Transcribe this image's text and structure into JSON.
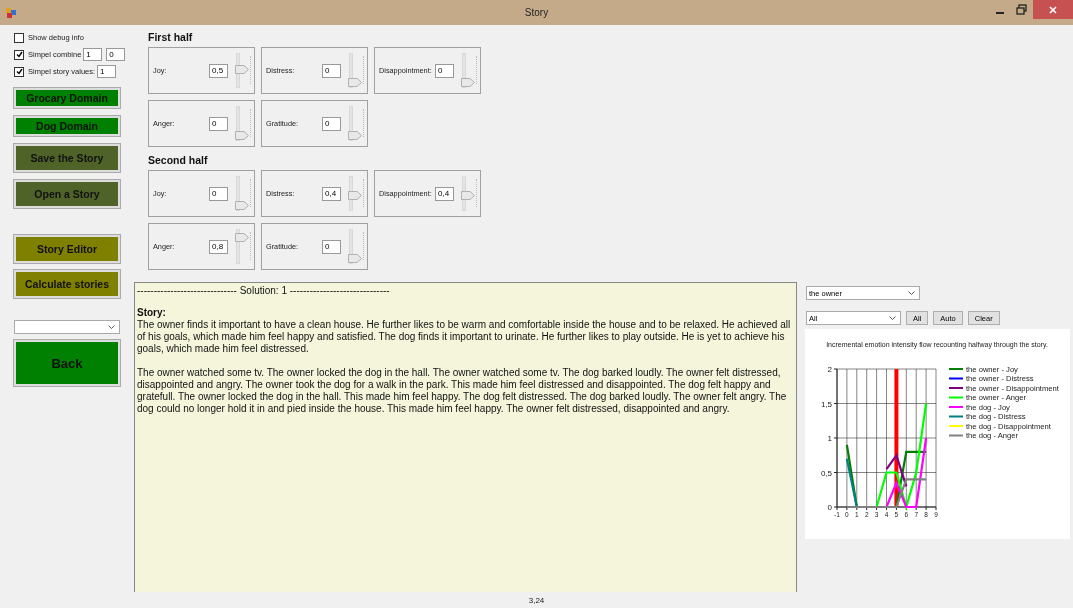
{
  "window": {
    "title": "Story"
  },
  "options": [
    {
      "label": "Show debug info",
      "checked": false
    },
    {
      "label": "Simpel combine",
      "checked": true,
      "fields": [
        "1",
        "0"
      ]
    },
    {
      "label": "Simpel story values:",
      "checked": true,
      "fields": [
        "1"
      ]
    }
  ],
  "actions": [
    {
      "label": "Grocary Domain",
      "kind": "domain"
    },
    {
      "label": "Dog Domain",
      "kind": "domain"
    },
    {
      "label": "Save the Story",
      "kind": "file"
    },
    {
      "label": "Open a Story",
      "kind": "file"
    },
    {
      "label": "Story Editor",
      "kind": "tool"
    },
    {
      "label": "Calculate stories",
      "kind": "tool"
    }
  ],
  "back_button": {
    "label": "Back"
  },
  "halves": [
    {
      "title": "First half",
      "emotions": [
        {
          "label": "Joy:",
          "value": "0,5",
          "level": 0.5
        },
        {
          "label": "Distress:",
          "value": "0",
          "level": 0
        },
        {
          "label": "Disappointment:",
          "value": "0",
          "level": 0
        },
        {
          "label": "Anger:",
          "value": "0",
          "level": 0
        },
        {
          "label": "Gratitude:",
          "value": "0",
          "level": 0
        }
      ]
    },
    {
      "title": "Second half",
      "emotions": [
        {
          "label": "Joy:",
          "value": "0",
          "level": 0
        },
        {
          "label": "Distress:",
          "value": "0,4",
          "level": 0.4
        },
        {
          "label": "Disappointment:",
          "value": "0,4",
          "level": 0.4
        },
        {
          "label": "Anger:",
          "value": "0,8",
          "level": 0.8
        },
        {
          "label": "Gratitude:",
          "value": "0",
          "level": 0
        }
      ]
    }
  ],
  "output": {
    "separator": "------------------------------ Solution: 1 ------------------------------",
    "heading": "Story:",
    "paragraphs": [
      "The owner finds it important to have a clean house. He further likes to be warm and comfortable inside the house and to be relaxed. He achieved all of his goals, which made him feel happy and satisfied. The dog finds it important to urinate. He further likes to play outside. He is yet to achieve his goals, which made him feel distressed.",
      "The owner watched some tv. The owner locked the dog in the hall. The owner watched some tv. The dog barked loudly. The owner felt distressed, disappointed and angry. The owner took the dog for a walk in the park. This made him feel distressed and disappointed. The dog felt happy and gratefull. The owner locked the dog in the hall. This made him feel happy. The dog felt distressed. The dog barked loudly. The owner felt angry. The dog could no longer hold it in and pied inside the house. This made him feel happy. The owner felt distressed, disappointed and angry."
    ]
  },
  "character_select": {
    "value": "the owner"
  },
  "emotion_select": {
    "value": "All"
  },
  "chart_buttons": [
    "All",
    "Auto",
    "Clear"
  ],
  "chart": {
    "chart_data": {
      "type": "line",
      "title": "Incremental emotion intensity flow recounting halfway through the story.",
      "x": [
        0,
        1,
        2,
        3,
        4,
        5,
        6,
        7,
        8
      ],
      "xlim": [
        -1,
        9
      ],
      "ylim": [
        0,
        2
      ],
      "xticks": [
        -1,
        0,
        1,
        2,
        3,
        4,
        5,
        6,
        7,
        8,
        9
      ],
      "yticks": [
        {
          "value": 0,
          "label": "0"
        },
        {
          "value": 0.5,
          "label": "0,5"
        },
        {
          "value": 1,
          "label": "1"
        },
        {
          "value": 1.5,
          "label": "1,5"
        },
        {
          "value": 2,
          "label": "2"
        }
      ],
      "grid": true,
      "legend": true,
      "series": [
        {
          "name": "the owner - Joy",
          "color": "#008000",
          "values": [
            0.9,
            0,
            null,
            null,
            null,
            0,
            0.8,
            0.8,
            0.8
          ]
        },
        {
          "name": "the owner - Distress",
          "color": "#0000ff",
          "values": [
            null,
            null,
            null,
            null,
            null,
            null,
            null,
            null,
            null
          ]
        },
        {
          "name": "the owner - Disappointment",
          "color": "#800080",
          "values": [
            null,
            null,
            null,
            null,
            0.55,
            0.75,
            0.3,
            null,
            null
          ]
        },
        {
          "name": "the owner - Anger",
          "color": "#00ff00",
          "values": [
            null,
            null,
            null,
            0,
            0.5,
            0.5,
            0,
            0.5,
            1.5
          ]
        },
        {
          "name": "the dog - Joy",
          "color": "#ff00ff",
          "values": [
            null,
            null,
            null,
            null,
            0,
            0.35,
            0,
            0,
            1
          ]
        },
        {
          "name": "the dog - Distress",
          "color": "#008080",
          "values": [
            0.7,
            0,
            null,
            null,
            null,
            null,
            null,
            null,
            null
          ]
        },
        {
          "name": "the dog - Disappointment",
          "color": "#ffff00",
          "values": [
            null,
            null,
            null,
            null,
            null,
            null,
            null,
            null,
            null
          ]
        },
        {
          "name": "the dog - Anger",
          "color": "#808080",
          "values": [
            0,
            0,
            0,
            0,
            0,
            0,
            0.4,
            0.4,
            0.4
          ]
        }
      ],
      "ref_lines": [
        {
          "axis": "x",
          "value": 5
        }
      ]
    }
  },
  "status_bar": {
    "text": "3,24"
  }
}
